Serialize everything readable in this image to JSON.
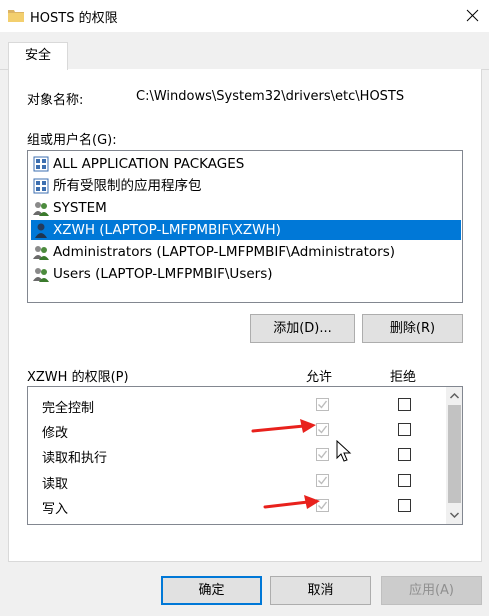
{
  "window": {
    "title": "HOSTS 的权限",
    "close_glyph": "✕"
  },
  "tabs": [
    {
      "label": "安全"
    }
  ],
  "object": {
    "label": "对象名称:",
    "value": "C:\\Windows\\System32\\drivers\\etc\\HOSTS"
  },
  "groups": {
    "label": "组或用户名(G):",
    "items": [
      {
        "name": "ALL APPLICATION PACKAGES",
        "icon": "app-package-icon"
      },
      {
        "name": "所有受限制的应用程序包",
        "icon": "app-package-icon"
      },
      {
        "name": "SYSTEM",
        "icon": "users-group-icon"
      },
      {
        "name": "XZWH (LAPTOP-LMFPMBIF\\XZWH)",
        "icon": "user-icon",
        "selected": true
      },
      {
        "name": "Administrators (LAPTOP-LMFPMBIF\\Administrators)",
        "icon": "users-group-icon"
      },
      {
        "name": "Users (LAPTOP-LMFPMBIF\\Users)",
        "icon": "users-group-icon"
      }
    ]
  },
  "buttons": {
    "add": "添加(D)...",
    "remove": "删除(R)",
    "ok": "确定",
    "cancel": "取消",
    "apply": "应用(A)"
  },
  "permissions": {
    "title": "XZWH 的权限(P)",
    "allow_header": "允许",
    "deny_header": "拒绝",
    "rows": [
      {
        "name": "完全控制",
        "allow": true,
        "allow_disabled": true,
        "deny": false
      },
      {
        "name": "修改",
        "allow": true,
        "allow_disabled": true,
        "deny": false
      },
      {
        "name": "读取和执行",
        "allow": true,
        "allow_disabled": true,
        "deny": false
      },
      {
        "name": "读取",
        "allow": true,
        "allow_disabled": true,
        "deny": false
      },
      {
        "name": "写入",
        "allow": true,
        "allow_disabled": true,
        "deny": false
      }
    ]
  },
  "colors": {
    "selection": "#0078d7",
    "annotation_arrow": "#e8211c",
    "disabled_check": "#bcbcbc"
  }
}
